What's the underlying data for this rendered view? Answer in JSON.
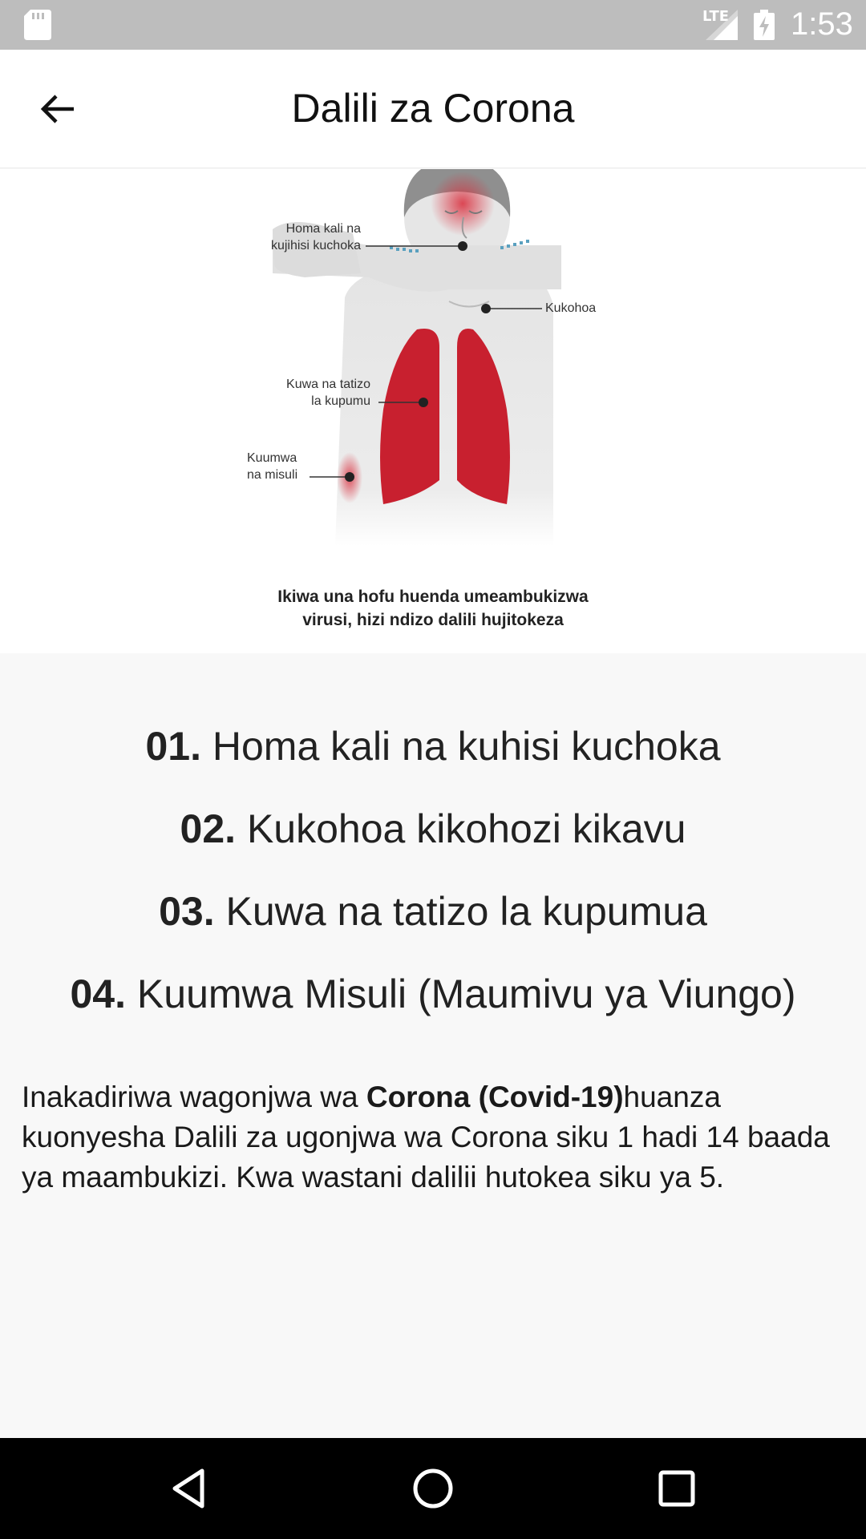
{
  "status_bar": {
    "network_label": "LTE",
    "time": "1:53",
    "icons": [
      "sd-card-icon",
      "signal-icon",
      "battery-charging-icon"
    ]
  },
  "app_bar": {
    "title": "Dalili za Corona",
    "back_icon": "arrow-left-icon"
  },
  "illustration": {
    "labels": {
      "fever": "Homa kali na kujihisi kuchoka",
      "fever_line1": "Homa kali na",
      "fever_line2": "kujihisi kuchoka",
      "cough": "Kukohoa",
      "breath_line1": "Kuwa na tatizo",
      "breath_line2": "la kupumu",
      "muscle_line1": "Kuumwa",
      "muscle_line2": "na misuli"
    },
    "caption_line1": "Ikiwa una hofu huenda umeambukizwa",
    "caption_line2": "virusi, hizi ndizo dalili hujitokeza",
    "colors": {
      "lungs": "#c8202f",
      "body": "#e6e6e6",
      "hair": "#8f8f8f",
      "cough_dots": "#5aa0bf"
    }
  },
  "symptoms": [
    {
      "number": "01.",
      "text": "Homa kali na kuhisi kuchoka"
    },
    {
      "number": "02.",
      "text": "Kukohoa kikohozi kikavu"
    },
    {
      "number": "03.",
      "text": "Kuwa na tatizo la kupumua"
    },
    {
      "number": "04.",
      "text": "Kuumwa Misuli (Maumivu ya Viungo)"
    }
  ],
  "description": {
    "before": "Inakadiriwa wagonjwa wa ",
    "bold": "Corona (Covid-19)",
    "after": "huanza kuonyesha Dalili za ugonjwa wa Corona siku 1 hadi 14 baada ya maambukizi. Kwa wastani dalilii hutokea siku ya 5."
  },
  "nav_bar": {
    "icons": [
      "back-triangle-icon",
      "home-circle-icon",
      "recents-square-icon"
    ]
  }
}
